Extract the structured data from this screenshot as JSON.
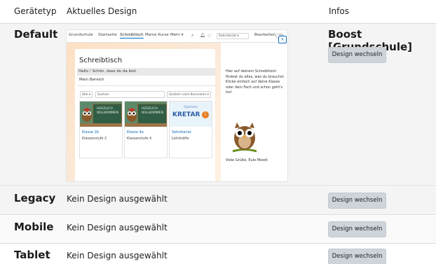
{
  "header": {
    "col_device": "Gerätetyp",
    "col_design": "Aktuelles Design",
    "col_info": "Infos"
  },
  "rows": [
    {
      "device": "Default",
      "design": "",
      "theme": "Boost [Grundschule]",
      "button": "Design wechseln"
    },
    {
      "device": "Legacy",
      "design": "Kein Design ausgewählt",
      "button": "Design wechseln"
    },
    {
      "device": "Mobile",
      "design": "Kein Design ausgewählt",
      "button": "Design wechseln"
    },
    {
      "device": "Tablet",
      "design": "Kein Design ausgewählt",
      "button": "Design wechseln"
    }
  ],
  "preview": {
    "nav": [
      "Grundschule",
      "Startseite",
      "Schreibtisch",
      "Meine Kurse",
      "Mehr ▾"
    ],
    "search_icon": "search-icon",
    "bell_icon": "bell-icon",
    "chat_icon": "chat-icon",
    "user_menu": "Sekretariat ▾",
    "edit_label": "Bearbeiten",
    "title": "Schreibtisch",
    "greeting": "Hallo          ! Schön, dass du da bist.",
    "section": "Mein Bereich",
    "filter_all": "Alle ▾",
    "filter_search": "Suchen",
    "filter_sort": "Sortiert nach Kursname ▾",
    "courses": [
      {
        "name": "Klasse 2b",
        "category": "Klassenstufe 2",
        "board": "HERZLICH WILLKOMMEN"
      },
      {
        "name": "Klasse 4a",
        "category": "Klassenstufe 4",
        "board": "HERZLICH WILLKOMMEN"
      },
      {
        "name": "Sekretariat",
        "category": "Lehrkräfte",
        "banner_top": "Digitales",
        "banner_main": "KRETAR",
        "banner_badge": "i"
      }
    ],
    "close_button": "×",
    "drawer_text": "Hier auf deinem Schreibtisch findest du alles, was du brauchst. Klicke einfach auf deine Klasse oder dein Fach und schon geht's los!",
    "signature": "Viele Grüße, Eule Moodi"
  },
  "colors": {
    "accent": "#0f6cbf",
    "button_bg": "#ced4da",
    "row_shade": "#f4f4f4"
  }
}
